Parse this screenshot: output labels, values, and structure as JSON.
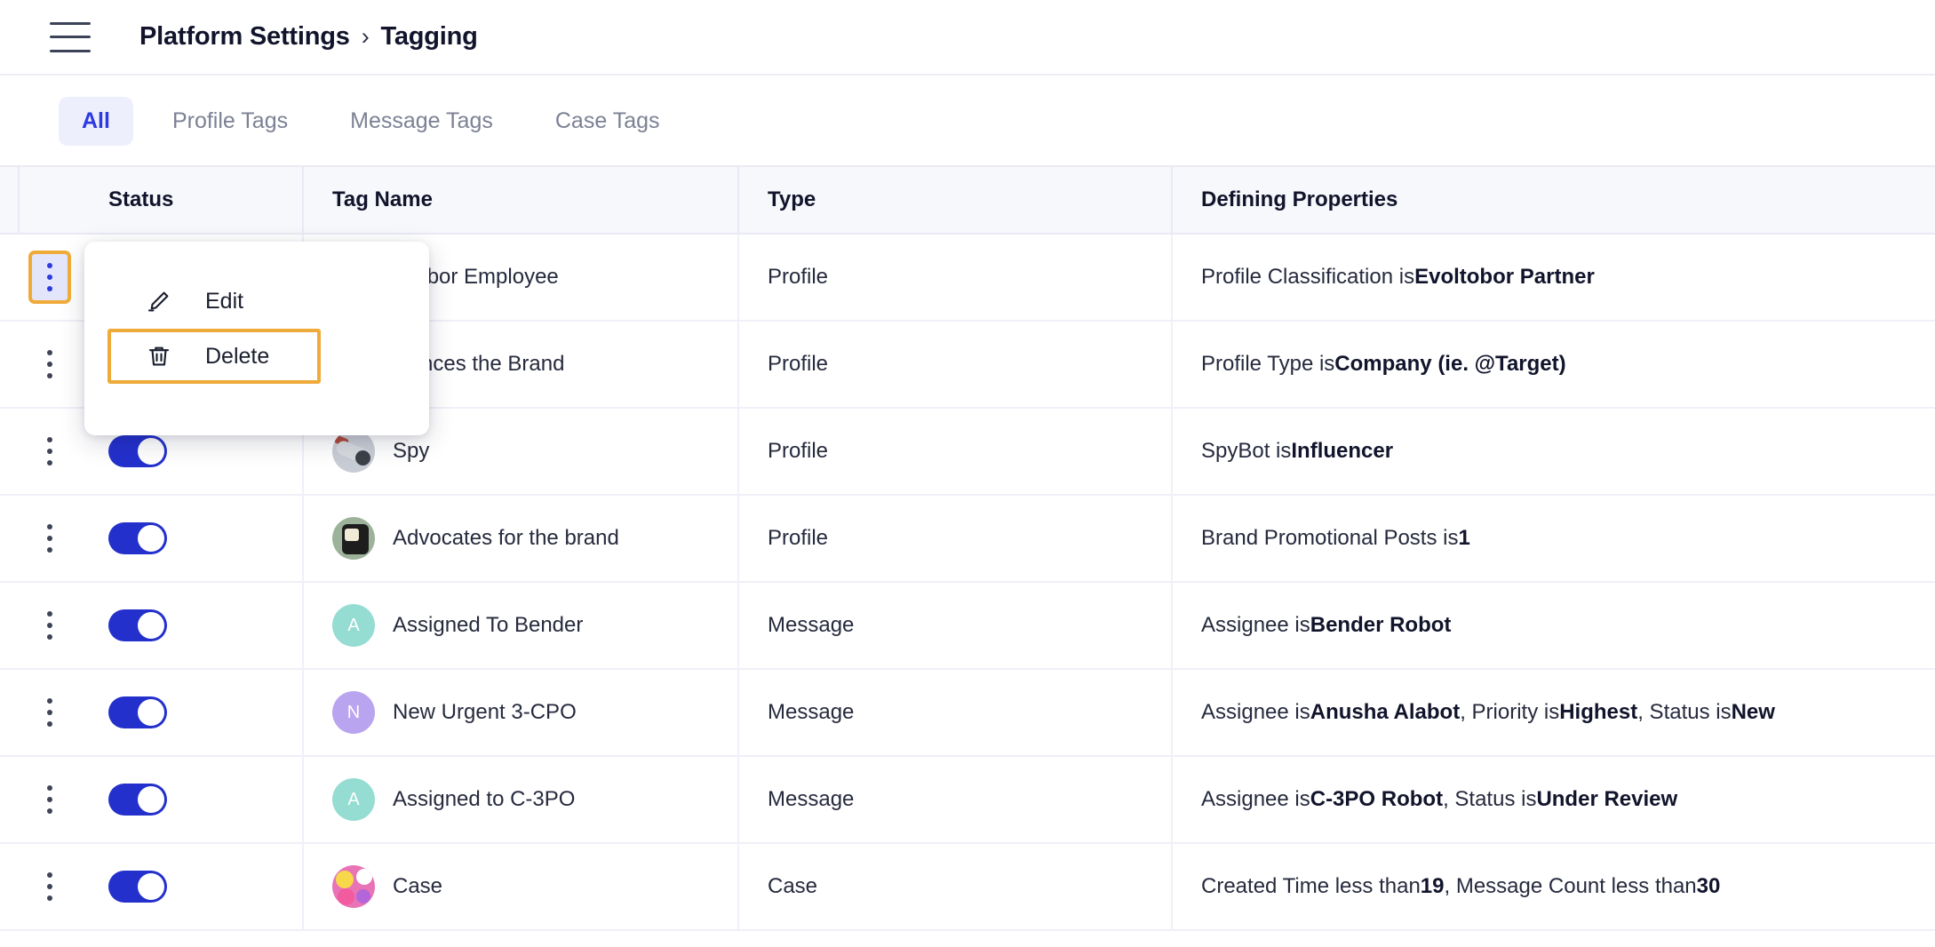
{
  "header": {
    "menu_icon": "hamburger-icon",
    "breadcrumb_root": "Platform Settings",
    "breadcrumb_separator": "›",
    "breadcrumb_current": "Tagging"
  },
  "tabs": [
    {
      "label": "All",
      "active": true
    },
    {
      "label": "Profile Tags",
      "active": false
    },
    {
      "label": "Message Tags",
      "active": false
    },
    {
      "label": "Case Tags",
      "active": false
    }
  ],
  "table": {
    "columns": [
      "Status",
      "Tag Name",
      "Type",
      "Defining Properties"
    ],
    "rows": [
      {
        "status_on": true,
        "tag_name": "oltobor Employee",
        "tag_name_full": "Evoltobor Employee",
        "avatar": {
          "kind": "hidden",
          "letter": ""
        },
        "type": "Profile",
        "props_prefix": "Profile Classification is ",
        "props_bold": "Evoltobor Partner",
        "props_suffix": ""
      },
      {
        "status_on": true,
        "tag_name": "luences the Brand",
        "tag_name_full": "Influences the Brand",
        "avatar": {
          "kind": "hidden",
          "letter": ""
        },
        "type": "Profile",
        "props_prefix": "Profile Type is ",
        "props_bold": "Company (ie. @Target)",
        "props_suffix": ""
      },
      {
        "status_on": true,
        "tag_name": "Spy",
        "avatar": {
          "kind": "img-spy",
          "letter": ""
        },
        "type": "Profile",
        "props_prefix": "SpyBot is ",
        "props_bold": "Influencer",
        "props_suffix": ""
      },
      {
        "status_on": true,
        "tag_name": "Advocates for the brand",
        "avatar": {
          "kind": "img-thumb",
          "letter": ""
        },
        "type": "Profile",
        "props_prefix": "Brand Promotional Posts is ",
        "props_bold": "1",
        "props_suffix": ""
      },
      {
        "status_on": true,
        "tag_name": "Assigned To Bender",
        "avatar": {
          "kind": "letter-teal",
          "letter": "A"
        },
        "type": "Message",
        "props_prefix": "Assignee is ",
        "props_bold": "Bender Robot",
        "props_suffix": ""
      },
      {
        "status_on": true,
        "tag_name": "New Urgent 3-CPO",
        "avatar": {
          "kind": "letter-purple",
          "letter": "N"
        },
        "type": "Message",
        "props_prefix": "Assignee is ",
        "props_bold": "Anusha Alabot",
        "props_mid1": ", Priority is ",
        "props_bold2": "Highest",
        "props_mid2": ", Status is ",
        "props_bold3": "New",
        "props_suffix": ""
      },
      {
        "status_on": true,
        "tag_name": "Assigned to C-3PO",
        "avatar": {
          "kind": "letter-teal",
          "letter": "A"
        },
        "type": "Message",
        "props_prefix": "Assignee is ",
        "props_bold": "C-3PO Robot",
        "props_mid1": ", Status is ",
        "props_bold2": "Under Review",
        "props_suffix": ""
      },
      {
        "status_on": true,
        "tag_name": "Case",
        "avatar": {
          "kind": "img-flower",
          "letter": ""
        },
        "type": "Case",
        "props_prefix": "Created Time less than ",
        "props_bold": "19",
        "props_mid1": ", Message Count less than ",
        "props_bold2": "30",
        "props_suffix": ""
      }
    ]
  },
  "context_menu": {
    "open_for_row": 0,
    "items": [
      {
        "label": "Edit",
        "icon": "pencil-icon",
        "highlighted": false
      },
      {
        "label": "Delete",
        "icon": "trash-icon",
        "highlighted": true
      }
    ]
  },
  "colors": {
    "accent_blue": "#2c3ae0",
    "toggle_on": "#2330cc",
    "highlight_amber": "#eeab3a",
    "tab_active_bg": "#eeeffc",
    "header_bg": "#f7f8fc"
  }
}
